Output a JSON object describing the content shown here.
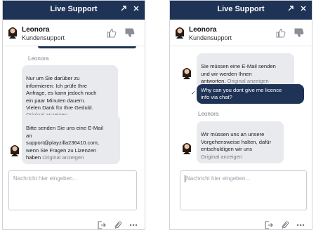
{
  "header": {
    "title": "Live Support"
  },
  "agent": {
    "name": "Leonora",
    "role": "Kundensupport"
  },
  "input": {
    "placeholder": "Nachricht hier eingeben..."
  },
  "colors": {
    "brand": "#1e3355",
    "bubble": "#e9eaee",
    "muted": "#7a7f86"
  },
  "left": {
    "sender": "Leonora",
    "msg1": {
      "text": "Nur um Sie darüber zu\ninformieren: Ich prüfe Ihre\nAnfrage, es kann jedoch noch\nein paar Minuten dauern.\nVielen Dank für Ihre Geduld.",
      "orig": "Original anzeigen"
    },
    "msg2": {
      "text": "Bitte senden Sie uns eine E-Mail\nan\nsupport@playzilla236410.com,\nwenn Sie Fragen zu Lizenzen\nhaben ",
      "orig": "Original anzeigen"
    }
  },
  "right": {
    "msg1": {
      "text": "Sie müssen eine E-Mail senden\nund wir werden Ihnen\nantworten. ",
      "orig": "Original anzeigen"
    },
    "user_msg": "Why can you dont give me licence\ninfo via chat?",
    "sender": "Leonora",
    "msg2": {
      "text": "Wir müssen uns an unsere\nVorgehensweise halten, dafür\nentschuldigen wir uns\n",
      "orig": "Original anzeigen"
    }
  },
  "icons": [
    "expand-icon",
    "close-icon",
    "thumbs-up-icon",
    "thumbs-down-icon",
    "exit-icon",
    "attach-icon",
    "more-icon"
  ]
}
